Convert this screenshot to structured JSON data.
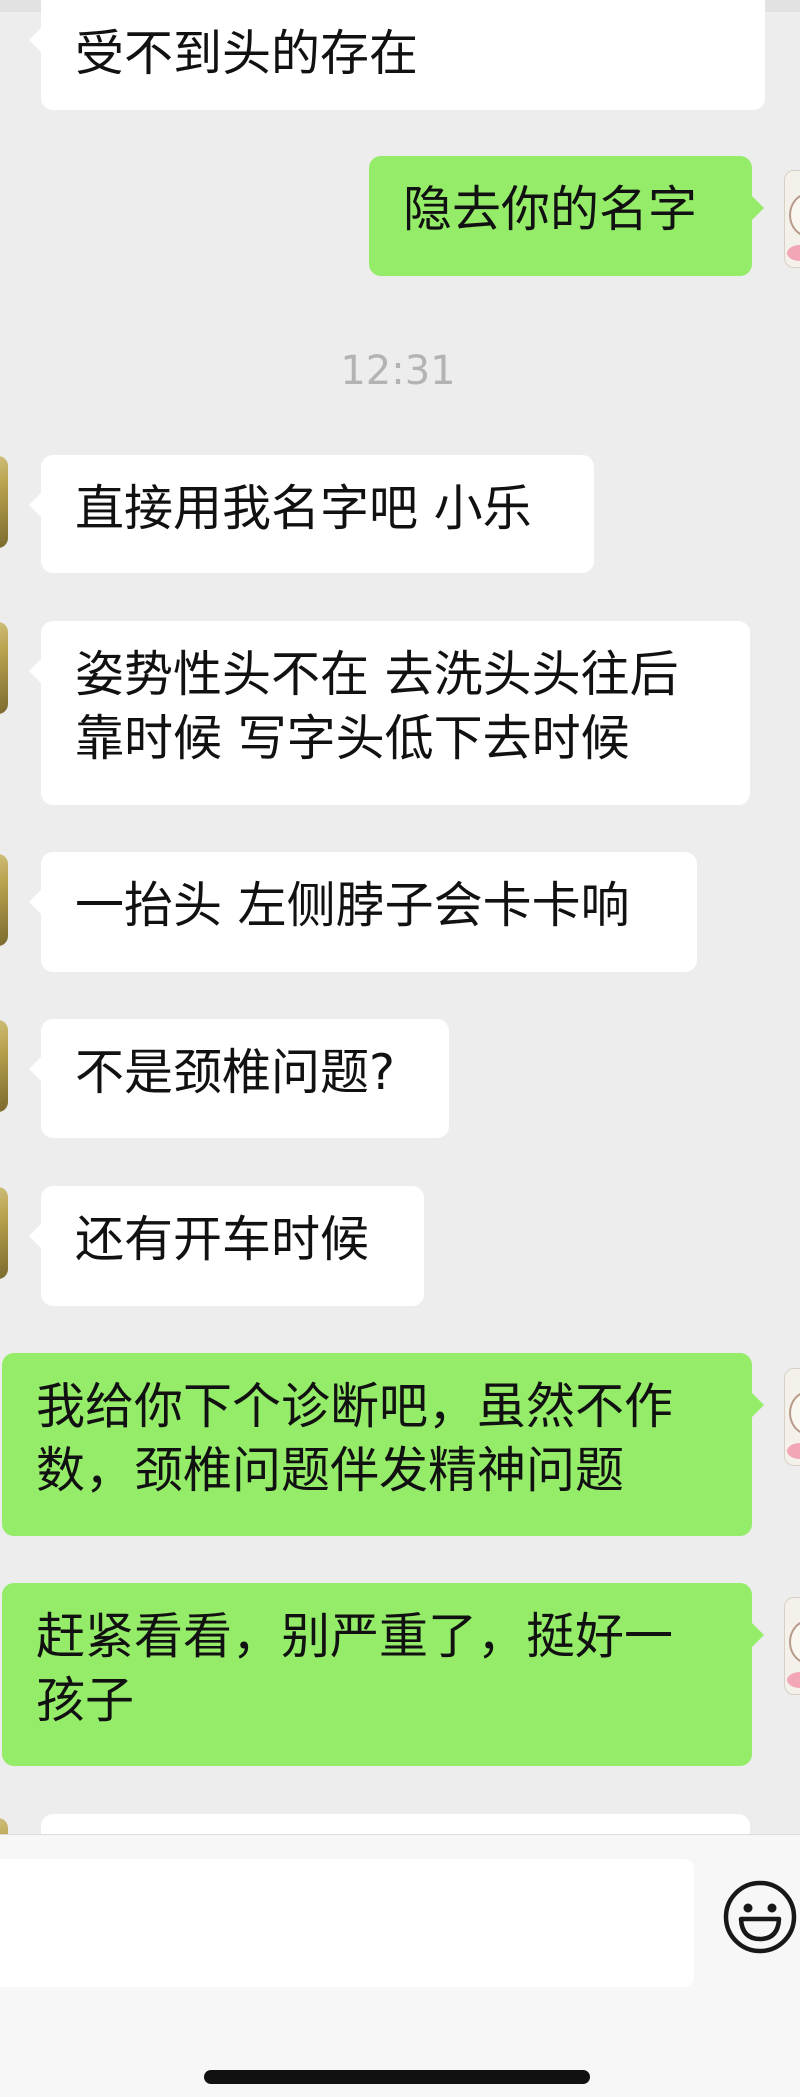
{
  "chat": {
    "timestamp": "12:31",
    "messages": [
      {
        "side": "in",
        "text": "受不到头的存在"
      },
      {
        "side": "out",
        "text": "隐去你的名字"
      },
      {
        "side": "in",
        "text": "直接用我名字吧 小乐"
      },
      {
        "side": "in",
        "text": "姿势性头不在 去洗头头往后\n靠时候 写字头低下去时候"
      },
      {
        "side": "in",
        "text": "一抬头 左侧脖子会卡卡响"
      },
      {
        "side": "in",
        "text": "不是颈椎问题?"
      },
      {
        "side": "in",
        "text": "还有开车时候"
      },
      {
        "side": "out",
        "text": "我给你下个诊断吧，虽然不作\n数，颈椎问题伴发精神问题"
      },
      {
        "side": "out",
        "text": "赶紧看看，别严重了，挺好一\n孩子"
      },
      {
        "side": "in",
        "text": ""
      }
    ]
  },
  "input_bar": {
    "value": "",
    "emoji_icon": "smiley-face-icon"
  },
  "colors": {
    "background": "#ededed",
    "incoming_bubble": "#ffffff",
    "outgoing_bubble": "#95ec69",
    "timestamp_text": "#b3b3b3"
  }
}
